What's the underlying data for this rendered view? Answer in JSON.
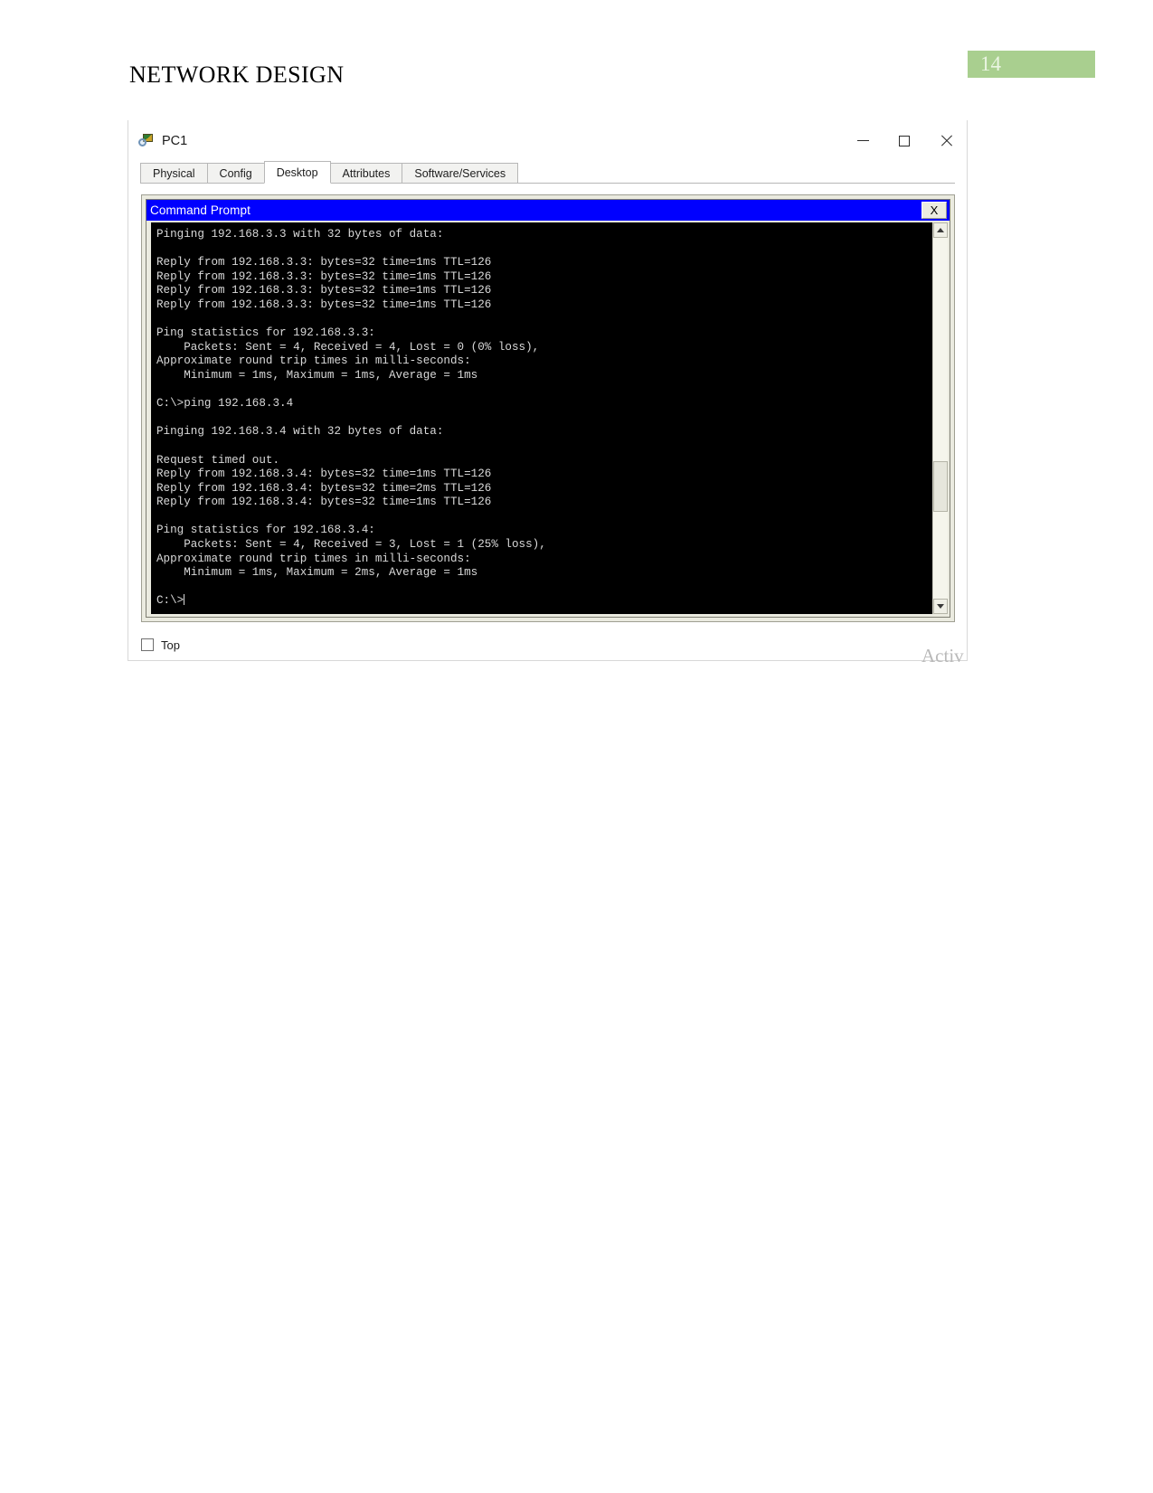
{
  "document": {
    "header_title": "NETWORK DESIGN",
    "page_number": "14",
    "page_badge_color": "#a9cf8f"
  },
  "window": {
    "title": "PC1",
    "app_icon": "packet-tracer-pc-icon",
    "controls": {
      "minimize": "–",
      "maximize": "□",
      "close": "✕"
    },
    "tabs": [
      {
        "label": "Physical",
        "active": false
      },
      {
        "label": "Config",
        "active": false
      },
      {
        "label": "Desktop",
        "active": true
      },
      {
        "label": "Attributes",
        "active": false
      },
      {
        "label": "Software/Services",
        "active": false
      }
    ]
  },
  "command_prompt": {
    "title": "Command Prompt",
    "title_bar_color": "#0000ff",
    "close_button_label": "X",
    "console_text": "Pinging 192.168.3.3 with 32 bytes of data:\n\nReply from 192.168.3.3: bytes=32 time=1ms TTL=126\nReply from 192.168.3.3: bytes=32 time=1ms TTL=126\nReply from 192.168.3.3: bytes=32 time=1ms TTL=126\nReply from 192.168.3.3: bytes=32 time=1ms TTL=126\n\nPing statistics for 192.168.3.3:\n    Packets: Sent = 4, Received = 4, Lost = 0 (0% loss),\nApproximate round trip times in milli-seconds:\n    Minimum = 1ms, Maximum = 1ms, Average = 1ms\n\nC:\\>ping 192.168.3.4\n\nPinging 192.168.3.4 with 32 bytes of data:\n\nRequest timed out.\nReply from 192.168.3.4: bytes=32 time=1ms TTL=126\nReply from 192.168.3.4: bytes=32 time=2ms TTL=126\nReply from 192.168.3.4: bytes=32 time=1ms TTL=126\n\nPing statistics for 192.168.3.4:\n    Packets: Sent = 4, Received = 3, Lost = 1 (25% loss),\nApproximate round trip times in milli-seconds:\n    Minimum = 1ms, Maximum = 2ms, Average = 1ms\n\nC:\\>",
    "scrollbar": {
      "up_arrow": "scroll-up-arrow-icon",
      "down_arrow": "scroll-down-arrow-icon"
    }
  },
  "footer": {
    "top_checkbox_label": "Top",
    "top_checkbox_checked": false
  },
  "watermark": {
    "text": "Activ"
  }
}
